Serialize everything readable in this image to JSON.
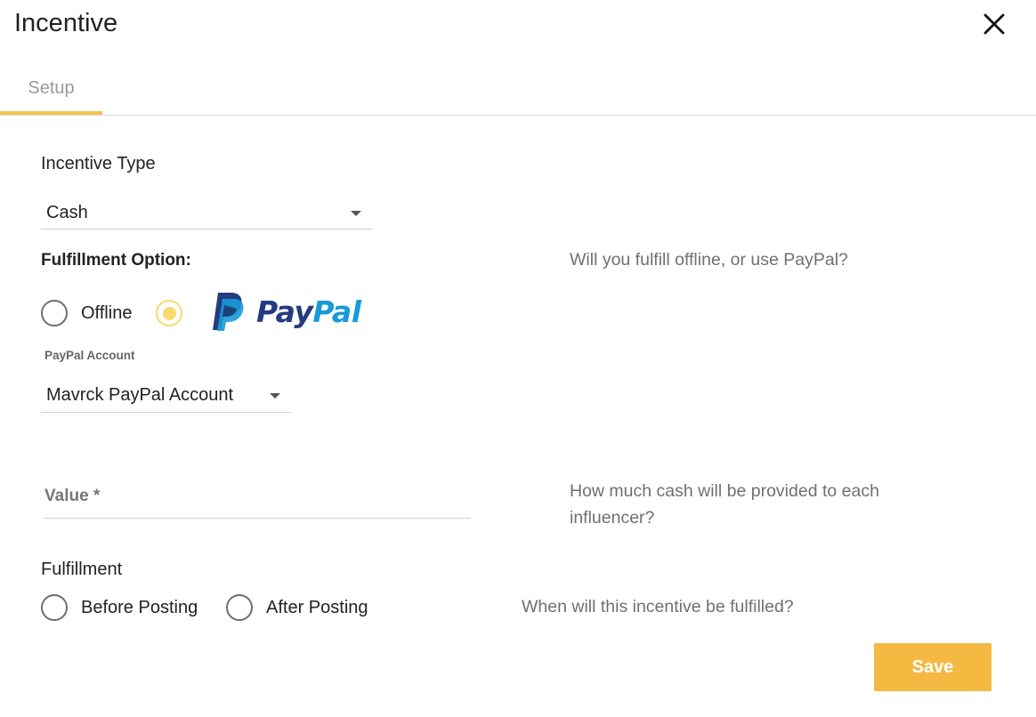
{
  "header": {
    "title": "Incentive",
    "close_icon": "close-icon"
  },
  "tabs": [
    {
      "label": "Setup",
      "active": true
    }
  ],
  "incentive_type": {
    "label": "Incentive Type",
    "selected": "Cash"
  },
  "fulfillment_option": {
    "label": "Fulfillment Option:",
    "hint": "Will you fulfill offline, or use PayPal?",
    "options": [
      {
        "label": "Offline",
        "checked": false
      },
      {
        "label": "PayPal",
        "checked": true
      }
    ]
  },
  "paypal_account": {
    "label": "PayPal Account",
    "selected": "Mavrck PayPal Account"
  },
  "value": {
    "placeholder": "Value *",
    "current": "",
    "hint": "How much cash will be provided to each influencer?"
  },
  "fulfillment": {
    "label": "Fulfillment",
    "hint": "When will this incentive be fulfilled?",
    "options": [
      {
        "label": "Before Posting",
        "checked": false
      },
      {
        "label": "After Posting",
        "checked": false
      }
    ]
  },
  "actions": {
    "save_label": "Save"
  },
  "colors": {
    "accent": "#f5c24a",
    "save_button": "#f5b942",
    "radio_selected": "#f8da6e",
    "paypal_dark": "#253b80",
    "paypal_light": "#179bd7"
  }
}
